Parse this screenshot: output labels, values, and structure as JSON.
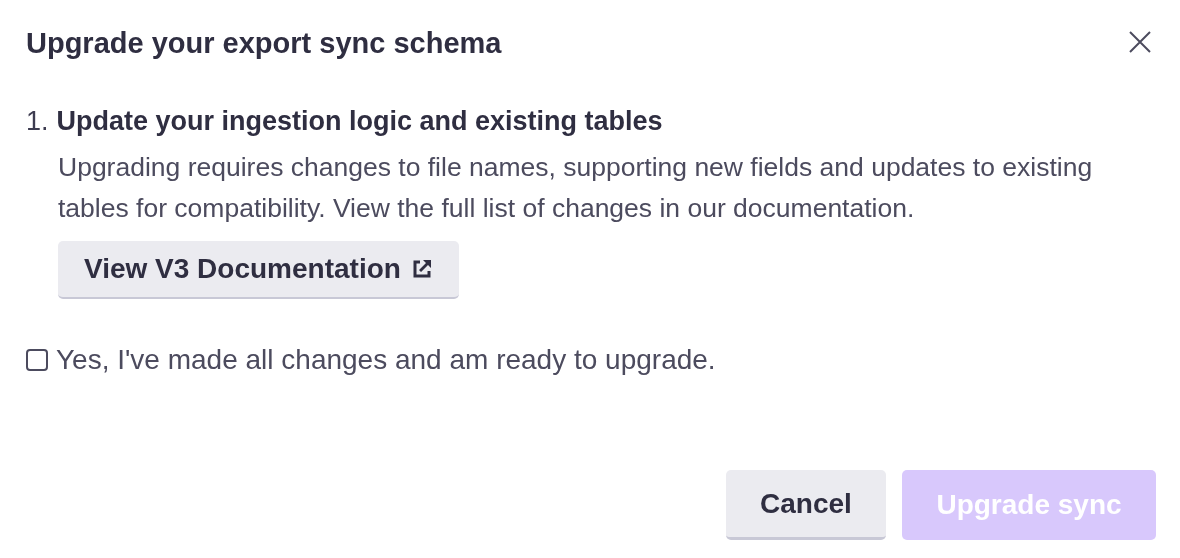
{
  "dialog": {
    "title": "Upgrade your export sync schema"
  },
  "steps": [
    {
      "number": "1.",
      "title": "Update your ingestion logic and existing tables",
      "description": "Upgrading requires changes to file names, supporting new fields and updates to existing tables for compatibility. View the full list of changes in our documentation.",
      "link_button": "View V3 Documentation"
    }
  ],
  "confirmation": {
    "label": "Yes, I've made all changes and am ready to upgrade.",
    "checked": false
  },
  "buttons": [
    {
      "label": "Cancel",
      "kind": "secondary",
      "disabled": false
    },
    {
      "label": "Upgrade sync",
      "kind": "primary",
      "disabled": true
    }
  ]
}
